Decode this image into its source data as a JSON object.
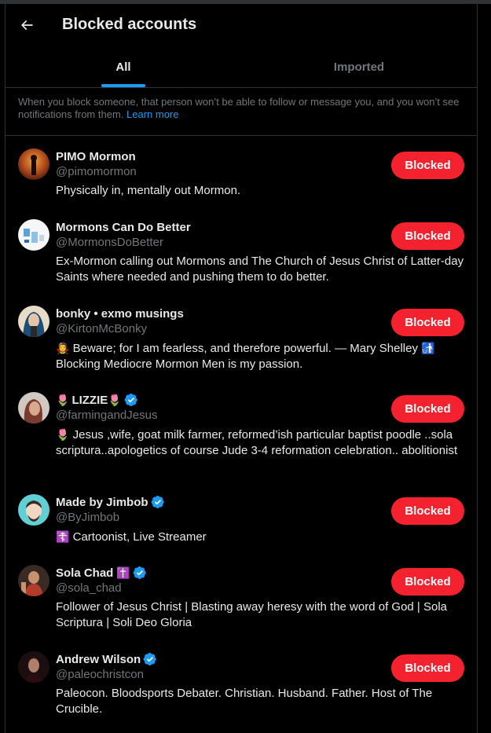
{
  "header": {
    "title": "Blocked accounts"
  },
  "tabs": [
    {
      "label": "All",
      "active": true
    },
    {
      "label": "Imported",
      "active": false
    }
  ],
  "notice": {
    "text": "When you block someone, that person won’t be able to follow or message you, and you won’t see notifications from them.",
    "link": "Learn more"
  },
  "accounts": [
    {
      "name": "PIMO Mormon",
      "handle": "@pimomormon",
      "bio": "Physically in, mentally out Mormon.",
      "verified": false,
      "button": "Blocked"
    },
    {
      "name": "Mormons Can Do Better",
      "handle": "@MormonsDoBetter",
      "bio": "Ex-Mormon calling out Mormons and The Church of Jesus Christ of Latter-day Saints where needed and pushing them to do better.",
      "verified": false,
      "button": "Blocked"
    },
    {
      "name": "bonky • exmo musings",
      "handle": "@KirtonMcBonky",
      "bio_emoji": "🧛‍♀️",
      "bio": "Beware; for I am fearless, and therefore powerful. — Mary Shelley",
      "bio_emoji_end": "🚮",
      "bio2": "Blocking Mediocre Mormon Men is my passion.",
      "verified": false,
      "button": "Blocked"
    },
    {
      "name_prefix": "🌷",
      "name": "LIZZIE",
      "name_suffix": "🌷",
      "handle": "@farmingandJesus",
      "bio_emoji": "🌷",
      "bio": "Jesus ,wife, goat milk farmer, reformed’ish particular baptist poodle ..sola scriptura..apologetics of course Jude 3-4 reformation celebration.. abolitionist",
      "verified": true,
      "button": "Blocked"
    },
    {
      "name": "Made by Jimbob",
      "handle": "@ByJimbob",
      "bio_emoji": "☦️",
      "bio": "Cartoonist, Live Streamer",
      "verified": true,
      "button": "Blocked"
    },
    {
      "name": "Sola Chad",
      "name_suffix": "✝️",
      "handle": "@sola_chad",
      "bio": "Follower of Jesus Christ | Blasting away heresy with the word of God | Sola Scriptura | Soli Deo Gloria",
      "verified": true,
      "button": "Blocked"
    },
    {
      "name": "Andrew Wilson",
      "handle": "@paleochristcon",
      "bio": "Paleocon. Bloodsports Debater. Christian. Husband. Father. Host of The Crucible.",
      "verified": true,
      "button": "Blocked"
    }
  ],
  "colors": {
    "background": "#000000",
    "text": "#e7e9ea",
    "muted": "#71767b",
    "accent": "#1d9bf0",
    "blocked_button": "#f4212e",
    "border": "#2f3336"
  },
  "icons": {
    "back": "arrow-left-icon",
    "verified": "verified-badge-icon"
  }
}
